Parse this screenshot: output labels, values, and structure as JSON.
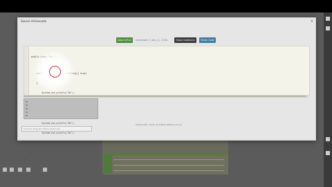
{
  "window": {
    "title": "Source Activecode",
    "close_label": "×"
  },
  "toolbar": {
    "save_label": "Save & Run",
    "status_text": "activecode: 1 (ac1_1) - 0.00s",
    "show_codelens_label": "Show CodeLens",
    "share_label": "Share Code"
  },
  "editor": {
    "lines": [
      "public class Test {",
      "",
      "    public static void main(String[] args)",
      "    {",
      "        System.out.println(\"Hi\");",
      "        System.out.println(\"Hi\");",
      "        System.out.println(\"Hi\");",
      "        System.out.println(\"Hi\");",
      "        System.out.println(\"Hi\");",
      "    }",
      "}"
    ]
  },
  "console": {
    "lines": [
      "Hi",
      "Hi",
      "Hi",
      "Hi",
      "Hi"
    ]
  },
  "info_text": "activecode: 1 (ac1_1) Output (stdout_ac1_1)",
  "stdin": {
    "placeholder": "Input for Program (stdin) (optional)"
  },
  "colors": {
    "save_button": "#4f8d3d",
    "codelens_button": "#3a3a3a",
    "share_button": "#3e7e9c",
    "page_accent": "#4e7a3c"
  },
  "icons": {
    "right_rail": [
      "close-icon",
      "fullscreen-icon",
      "scroll-up-icon",
      "scroll-down-icon"
    ],
    "bottom_tools": [
      "pointer-icon",
      "pen-icon",
      "highlighter-icon",
      "eraser-icon",
      "laser-icon"
    ]
  }
}
